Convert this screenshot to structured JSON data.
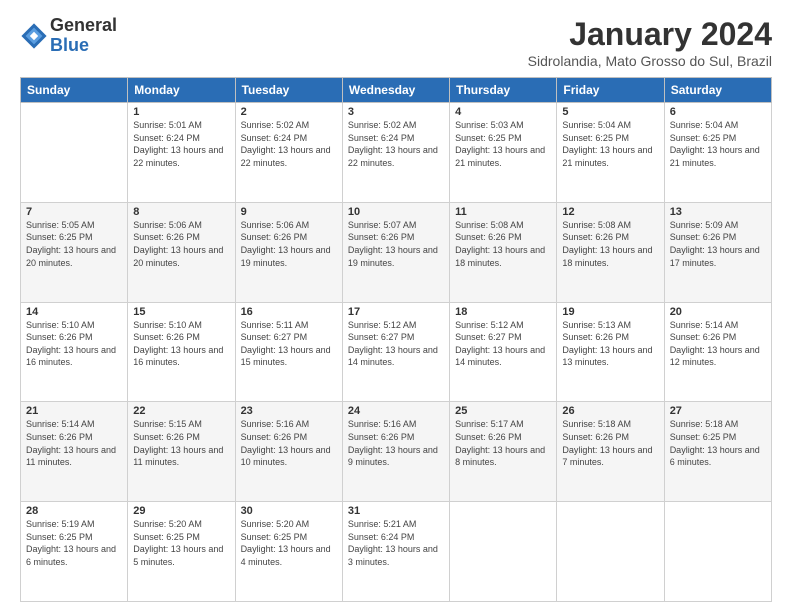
{
  "logo": {
    "general": "General",
    "blue": "Blue"
  },
  "header": {
    "title": "January 2024",
    "location": "Sidrolandia, Mato Grosso do Sul, Brazil"
  },
  "weekdays": [
    "Sunday",
    "Monday",
    "Tuesday",
    "Wednesday",
    "Thursday",
    "Friday",
    "Saturday"
  ],
  "weeks": [
    [
      {
        "day": "",
        "sunrise": "",
        "sunset": "",
        "daylight": ""
      },
      {
        "day": "1",
        "sunrise": "5:01 AM",
        "sunset": "6:24 PM",
        "daylight": "13 hours and 22 minutes."
      },
      {
        "day": "2",
        "sunrise": "5:02 AM",
        "sunset": "6:24 PM",
        "daylight": "13 hours and 22 minutes."
      },
      {
        "day": "3",
        "sunrise": "5:02 AM",
        "sunset": "6:24 PM",
        "daylight": "13 hours and 22 minutes."
      },
      {
        "day": "4",
        "sunrise": "5:03 AM",
        "sunset": "6:25 PM",
        "daylight": "13 hours and 21 minutes."
      },
      {
        "day": "5",
        "sunrise": "5:04 AM",
        "sunset": "6:25 PM",
        "daylight": "13 hours and 21 minutes."
      },
      {
        "day": "6",
        "sunrise": "5:04 AM",
        "sunset": "6:25 PM",
        "daylight": "13 hours and 21 minutes."
      }
    ],
    [
      {
        "day": "7",
        "sunrise": "5:05 AM",
        "sunset": "6:25 PM",
        "daylight": "13 hours and 20 minutes."
      },
      {
        "day": "8",
        "sunrise": "5:06 AM",
        "sunset": "6:26 PM",
        "daylight": "13 hours and 20 minutes."
      },
      {
        "day": "9",
        "sunrise": "5:06 AM",
        "sunset": "6:26 PM",
        "daylight": "13 hours and 19 minutes."
      },
      {
        "day": "10",
        "sunrise": "5:07 AM",
        "sunset": "6:26 PM",
        "daylight": "13 hours and 19 minutes."
      },
      {
        "day": "11",
        "sunrise": "5:08 AM",
        "sunset": "6:26 PM",
        "daylight": "13 hours and 18 minutes."
      },
      {
        "day": "12",
        "sunrise": "5:08 AM",
        "sunset": "6:26 PM",
        "daylight": "13 hours and 18 minutes."
      },
      {
        "day": "13",
        "sunrise": "5:09 AM",
        "sunset": "6:26 PM",
        "daylight": "13 hours and 17 minutes."
      }
    ],
    [
      {
        "day": "14",
        "sunrise": "5:10 AM",
        "sunset": "6:26 PM",
        "daylight": "13 hours and 16 minutes."
      },
      {
        "day": "15",
        "sunrise": "5:10 AM",
        "sunset": "6:26 PM",
        "daylight": "13 hours and 16 minutes."
      },
      {
        "day": "16",
        "sunrise": "5:11 AM",
        "sunset": "6:27 PM",
        "daylight": "13 hours and 15 minutes."
      },
      {
        "day": "17",
        "sunrise": "5:12 AM",
        "sunset": "6:27 PM",
        "daylight": "13 hours and 14 minutes."
      },
      {
        "day": "18",
        "sunrise": "5:12 AM",
        "sunset": "6:27 PM",
        "daylight": "13 hours and 14 minutes."
      },
      {
        "day": "19",
        "sunrise": "5:13 AM",
        "sunset": "6:26 PM",
        "daylight": "13 hours and 13 minutes."
      },
      {
        "day": "20",
        "sunrise": "5:14 AM",
        "sunset": "6:26 PM",
        "daylight": "13 hours and 12 minutes."
      }
    ],
    [
      {
        "day": "21",
        "sunrise": "5:14 AM",
        "sunset": "6:26 PM",
        "daylight": "13 hours and 11 minutes."
      },
      {
        "day": "22",
        "sunrise": "5:15 AM",
        "sunset": "6:26 PM",
        "daylight": "13 hours and 11 minutes."
      },
      {
        "day": "23",
        "sunrise": "5:16 AM",
        "sunset": "6:26 PM",
        "daylight": "13 hours and 10 minutes."
      },
      {
        "day": "24",
        "sunrise": "5:16 AM",
        "sunset": "6:26 PM",
        "daylight": "13 hours and 9 minutes."
      },
      {
        "day": "25",
        "sunrise": "5:17 AM",
        "sunset": "6:26 PM",
        "daylight": "13 hours and 8 minutes."
      },
      {
        "day": "26",
        "sunrise": "5:18 AM",
        "sunset": "6:26 PM",
        "daylight": "13 hours and 7 minutes."
      },
      {
        "day": "27",
        "sunrise": "5:18 AM",
        "sunset": "6:25 PM",
        "daylight": "13 hours and 6 minutes."
      }
    ],
    [
      {
        "day": "28",
        "sunrise": "5:19 AM",
        "sunset": "6:25 PM",
        "daylight": "13 hours and 6 minutes."
      },
      {
        "day": "29",
        "sunrise": "5:20 AM",
        "sunset": "6:25 PM",
        "daylight": "13 hours and 5 minutes."
      },
      {
        "day": "30",
        "sunrise": "5:20 AM",
        "sunset": "6:25 PM",
        "daylight": "13 hours and 4 minutes."
      },
      {
        "day": "31",
        "sunrise": "5:21 AM",
        "sunset": "6:24 PM",
        "daylight": "13 hours and 3 minutes."
      },
      {
        "day": "",
        "sunrise": "",
        "sunset": "",
        "daylight": ""
      },
      {
        "day": "",
        "sunrise": "",
        "sunset": "",
        "daylight": ""
      },
      {
        "day": "",
        "sunrise": "",
        "sunset": "",
        "daylight": ""
      }
    ]
  ],
  "labels": {
    "sunrise_prefix": "Sunrise: ",
    "sunset_prefix": "Sunset: ",
    "daylight_prefix": "Daylight: "
  }
}
